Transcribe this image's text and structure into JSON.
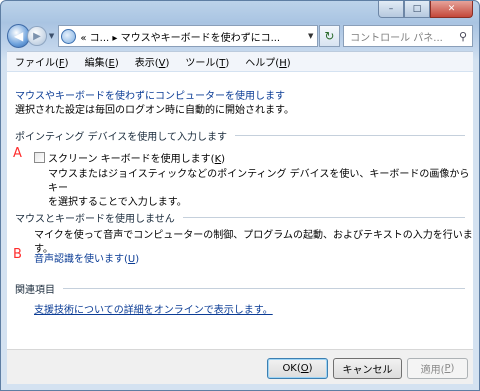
{
  "window": {
    "caption_buttons": {
      "minimize": "–",
      "maximize": "□",
      "close": "✕"
    }
  },
  "nav": {
    "back_glyph": "◀",
    "forward_glyph": "▶",
    "history_drop": "▼",
    "address_text": "« コ... ▸ マウスやキーボードを使わずにコ...",
    "address_drop": "▼",
    "refresh_glyph": "↻",
    "search_placeholder": "コントロール パネ...",
    "search_glyph": "⚲"
  },
  "menu": {
    "file": {
      "label": "ファイル(",
      "key": "F",
      "end": ")"
    },
    "edit": {
      "label": "編集(",
      "key": "E",
      "end": ")"
    },
    "view": {
      "label": "表示(",
      "key": "V",
      "end": ")"
    },
    "tools": {
      "label": "ツール(",
      "key": "T",
      "end": ")"
    },
    "help": {
      "label": "ヘルプ(",
      "key": "H",
      "end": ")"
    }
  },
  "main": {
    "title": "マウスやキーボードを使わずにコンピューターを使用します",
    "subtitle": "選択された設定は毎回のログオン時に自動的に開始されます。",
    "section_pointing": "ポインティング デバイスを使用して入力します",
    "marker_a": "A",
    "onscreen_keyboard_label": "スクリーン キーボードを使用します(",
    "onscreen_keyboard_key": "K",
    "onscreen_keyboard_end": ")",
    "onscreen_keyboard_checked": false,
    "onscreen_desc_line1": "マウスまたはジョイスティックなどのポインティング デバイスを使い、キーボードの画像からキー",
    "onscreen_desc_line2": "を選択することで入力します。",
    "section_no_mouse": "マウスとキーボードを使用しません",
    "speech_desc": "マイクを使って音声でコンピューターの制御、プログラムの起動、およびテキストの入力を行います。",
    "marker_b": "B",
    "speech_link": "音声認識を使います(",
    "speech_link_key": "U",
    "speech_link_end": ")",
    "section_related": "関連項目",
    "related_link": "支援技術についての詳細をオンラインで表示します。"
  },
  "buttons": {
    "ok": {
      "label": "OK(",
      "key": "O",
      "end": ")"
    },
    "cancel": "キャンセル",
    "apply": {
      "label": "適用(",
      "key": "P",
      "end": ")"
    }
  },
  "colors": {
    "link": "#0b3c95",
    "marker": "#ff2c2c"
  }
}
